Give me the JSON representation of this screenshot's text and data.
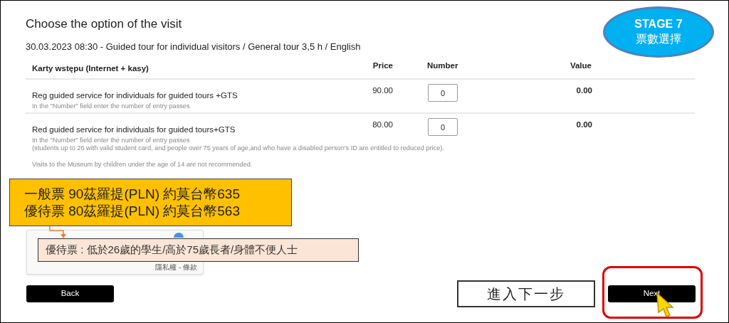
{
  "page": {
    "title": "Choose the option of the visit",
    "subtitle": "30.03.2023 08:30 - Guided tour for individual visitors / General tour 3,5 h / English"
  },
  "table": {
    "columns": [
      "Karty wstępu (Internet + kasy)",
      "Price",
      "Number",
      "Value"
    ],
    "rows": [
      {
        "name": "Reg guided service for individuals for guided tours +GTS",
        "price": "90.00",
        "number": "0",
        "value": "0.00",
        "notes": [
          "In the \"Number\" field enter the number of entry passes"
        ]
      },
      {
        "name": "Red guided service for individuals for guided tours+GTS",
        "price": "80.00",
        "number": "0",
        "value": "0.00",
        "notes": [
          "In the \"Number\" field enter the number of entry passes",
          "(students up to 26 with valid student card, and people over 75 years of age,and who have a disabled person's ID are entitled to reduced price)."
        ]
      }
    ],
    "footnote": "Visits to the Museum by children under the age of 14 are not recommended."
  },
  "captcha": {
    "links": "隱私權 - 條款"
  },
  "buttons": {
    "back": "Back",
    "next": "Next"
  },
  "annotations": {
    "stage": {
      "title": "STAGE 7",
      "subtitle": "票數選擇"
    },
    "prices": [
      "一般票 90茲羅提(PLN) 約莫台幣635",
      "優待票 80茲羅提(PLN) 約莫台幣563"
    ],
    "reduced_note": "優待票 : 低於26歲的學生/高於75歲長者/身體不便人士",
    "next_label": "進入下一步"
  }
}
